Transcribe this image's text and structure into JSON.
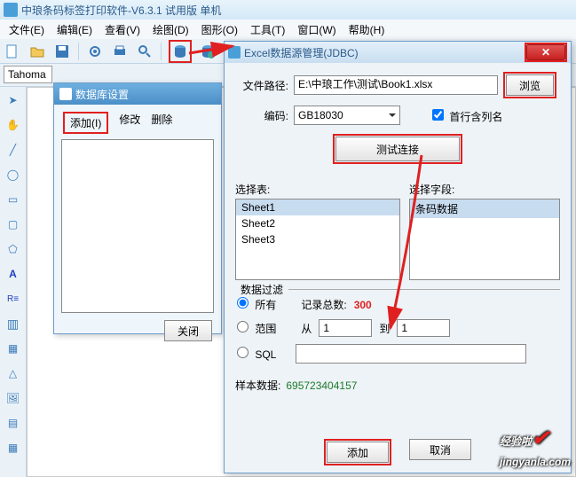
{
  "app": {
    "title": "中琅条码标签打印软件-V6.3.1 试用版 单机"
  },
  "menu": [
    "文件(E)",
    "编辑(E)",
    "查看(V)",
    "绘图(D)",
    "图形(O)",
    "工具(T)",
    "窗口(W)",
    "帮助(H)"
  ],
  "fontbar": {
    "fontname": "Tahoma"
  },
  "dbDialog": {
    "title": "数据库设置",
    "tabs": {
      "add": "添加(I)",
      "modify": "修改",
      "delete": "删除"
    },
    "closeBtn": "关闭"
  },
  "excelDialog": {
    "title": "Excel数据源管理(JDBC)",
    "pathLabel": "文件路径:",
    "pathValue": "E:\\中琅工作\\测试\\Book1.xlsx",
    "browseBtn": "浏览",
    "encLabel": "编码:",
    "encValue": "GB18030",
    "firstRowCol": "首行含列名",
    "testBtn": "测试连接",
    "selTableLabel": "选择表:",
    "selFieldLabel": "选择字段:",
    "sheets": [
      "Sheet1",
      "Sheet2",
      "Sheet3"
    ],
    "fields": [
      "条码数据"
    ],
    "filterTitle": "数据过滤",
    "radioAll": "所有",
    "recordCountLabel": "记录总数:",
    "recordCount": "300",
    "radioRange": "范围",
    "fromLabel": "从",
    "toLabel": "到",
    "fromVal": "1",
    "toVal": "1",
    "radioSQL": "SQL",
    "sampleLabel": "样本数据:",
    "sampleValue": "695723404157",
    "addBtn": "添加",
    "cancelBtn": "取消"
  },
  "watermark": {
    "text": "经验啦",
    "domain": "jingyanla.com"
  }
}
